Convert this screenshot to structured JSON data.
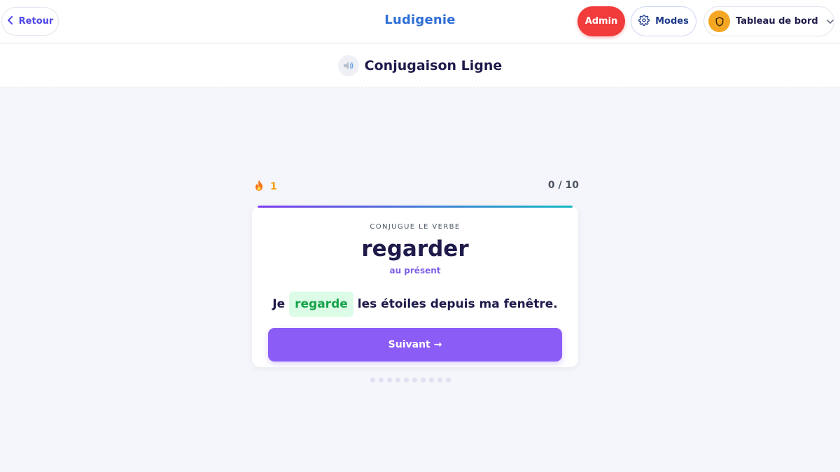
{
  "header": {
    "back_label": "Retour",
    "brand": "Ludigenie",
    "admin_label": "Admin",
    "modes_label": "Modes",
    "dashboard_label": "Tableau de bord"
  },
  "subheader": {
    "title": "Conjugaison Ligne"
  },
  "stats": {
    "streak": "1",
    "progress": "0 / 10"
  },
  "card": {
    "eyebrow": "CONJUGUE LE VERBE",
    "verb": "regarder",
    "tense": "au présent",
    "sentence_before": "Je",
    "answer": "regarde",
    "sentence_after": "les étoiles depuis ma fenêtre.",
    "next_label": "Suivant →"
  },
  "icons": {
    "back": "chevron-left-icon",
    "modes": "gear-icon",
    "dashboard": "shield-icon",
    "dropdown": "chevron-down-icon",
    "speaker": "speaker-icon",
    "streak": "flame-icon"
  },
  "colors": {
    "admin": "#f23b3b",
    "brand": "#2f6fd6",
    "primary": "#8b5cf6",
    "answer_bg": "#dcfce7",
    "answer_text": "#16a34a",
    "streak": "#f59e0b"
  },
  "question_dots": 10
}
